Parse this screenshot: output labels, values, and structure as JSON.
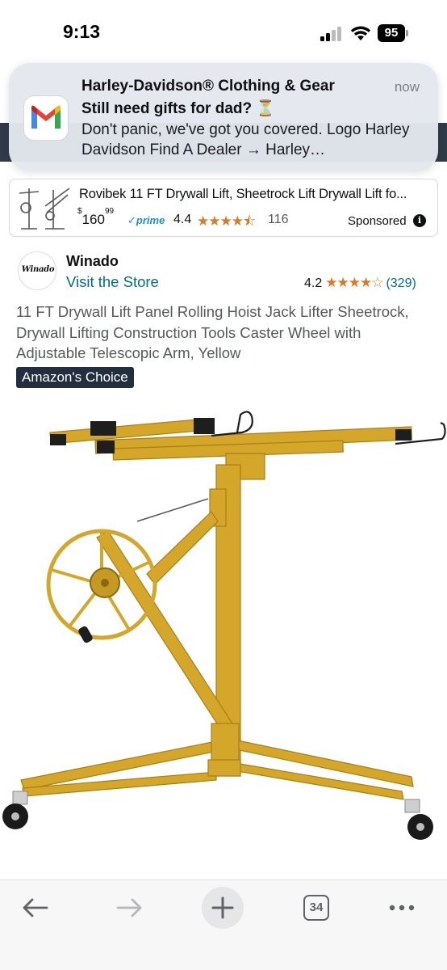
{
  "status_bar": {
    "time": "9:13",
    "battery": "95"
  },
  "notification": {
    "app_icon": "gmail-icon",
    "title": "Harley-Davidson® Clothing & Gear",
    "time": "now",
    "subtitle": "Still need gifts for dad? ⏳",
    "body": "Don't panic, we've got you covered. Logo Harley Davidson Find A Dealer → Harley…"
  },
  "sponsored_ad": {
    "title": "Rovibek 11 FT Drywall Lift, Sheetrock Lift Drywall Lift fo...",
    "price_currency": "$",
    "price_whole": "160",
    "price_fraction": "99",
    "prime_label": "✓prime",
    "rating": "4.4",
    "stars": "★★★★⯪",
    "review_count": "116",
    "sponsored_label": "Sponsored",
    "info_icon": "info-icon"
  },
  "brand": {
    "logo_text": "Winado",
    "name": "Winado",
    "store_link": "Visit the Store",
    "rating": "4.2",
    "stars": "★★★★☆",
    "review_count": "(329)"
  },
  "product": {
    "title": "11 FT Drywall Lift Panel Rolling Hoist Jack Lifter Sheetrock, Drywall Lifting Construction Tools Caster Wheel with Adjustable Telescopic Arm, Yellow",
    "badge": "Amazon's Choice"
  },
  "toolbar": {
    "tab_count": "34",
    "icons": [
      "back-arrow-icon",
      "forward-arrow-icon",
      "plus-icon",
      "tabs-icon",
      "more-icon"
    ]
  },
  "colors": {
    "link": "#007185",
    "star": "#de7921",
    "badge_bg": "#232f3e",
    "lift_yellow": "#d4a62a"
  }
}
